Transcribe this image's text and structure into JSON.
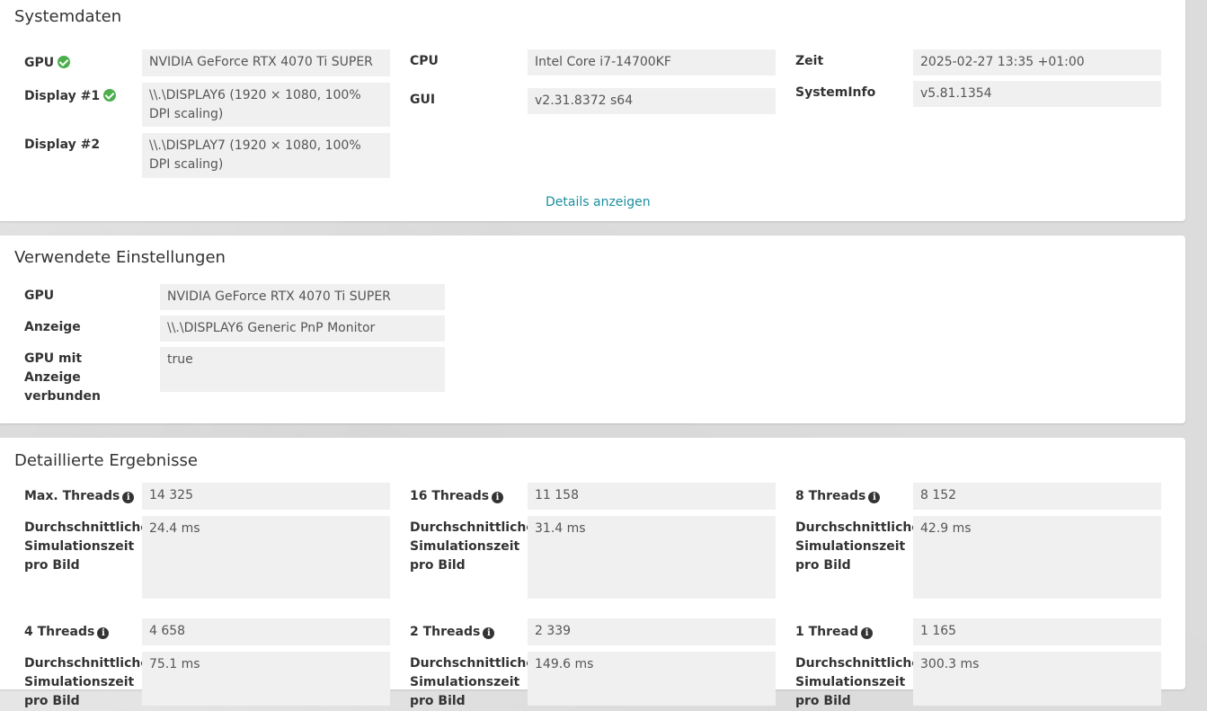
{
  "systemdaten": {
    "title": "Systemdaten",
    "gpu_label": "GPU",
    "gpu_value": "NVIDIA GeForce RTX 4070 Ti SUPER",
    "display1_label": "Display #1",
    "display1_value": "\\\\.\\DISPLAY6 (1920 × 1080, 100% DPI scaling)",
    "display2_label": "Display #2",
    "display2_value": "\\\\.\\DISPLAY7 (1920 × 1080, 100% DPI scaling)",
    "cpu_label": "CPU",
    "cpu_value": "Intel Core i7-14700KF",
    "gui_label": "GUI",
    "gui_value": "v2.31.8372 s64",
    "zeit_label": "Zeit",
    "zeit_value": "2025-02-27 13:35 +01:00",
    "systeminfo_label": "SystemInfo",
    "systeminfo_value": "v5.81.1354",
    "details_link": "Details anzeigen"
  },
  "einstellungen": {
    "title": "Verwendete Einstellungen",
    "gpu_label": "GPU",
    "gpu_value": "NVIDIA GeForce RTX 4070 Ti SUPER",
    "anzeige_label": "Anzeige",
    "anzeige_value": "\\\\.\\DISPLAY6 Generic PnP Monitor",
    "verbunden_label": "GPU mit Anzeige verbunden",
    "verbunden_value": "true"
  },
  "ergebnisse": {
    "title": "Detaillierte Ergebnisse",
    "avg_label": "Durchschnittliche Simulationszeit pro Bild",
    "max_threads_label": "Max. Threads",
    "max_threads_value": "14 325",
    "max_threads_avg": "24.4 ms",
    "t16_label": "16 Threads",
    "t16_value": "11 158",
    "t16_avg": "31.4 ms",
    "t8_label": "8 Threads",
    "t8_value": "8 152",
    "t8_avg": "42.9 ms",
    "t4_label": "4 Threads",
    "t4_value": "4 658",
    "t4_avg": "75.1 ms",
    "t2_label": "2 Threads",
    "t2_value": "2 339",
    "t2_avg": "149.6 ms",
    "t1_label": "1 Thread",
    "t1_value": "1 165",
    "t1_avg": "300.3 ms"
  }
}
